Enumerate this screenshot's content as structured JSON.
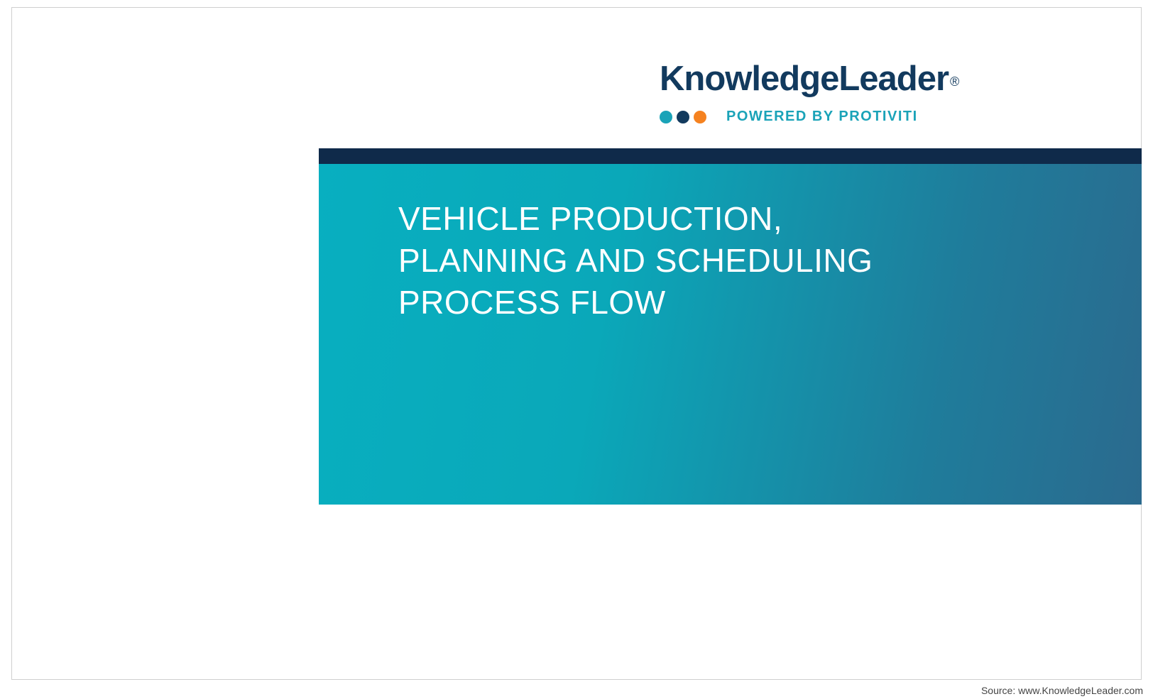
{
  "logo": {
    "name": "KnowledgeLeader",
    "registered": "®",
    "subline": "POWERED BY PROTIVITI",
    "dot_colors": [
      "#1aa3b8",
      "#123a5e",
      "#f58220"
    ]
  },
  "title": {
    "line1": "VEHICLE PRODUCTION,",
    "line2": "PLANNING AND SCHEDULING",
    "line3": "PROCESS FLOW"
  },
  "source": "Source: www.KnowledgeLeader.com"
}
